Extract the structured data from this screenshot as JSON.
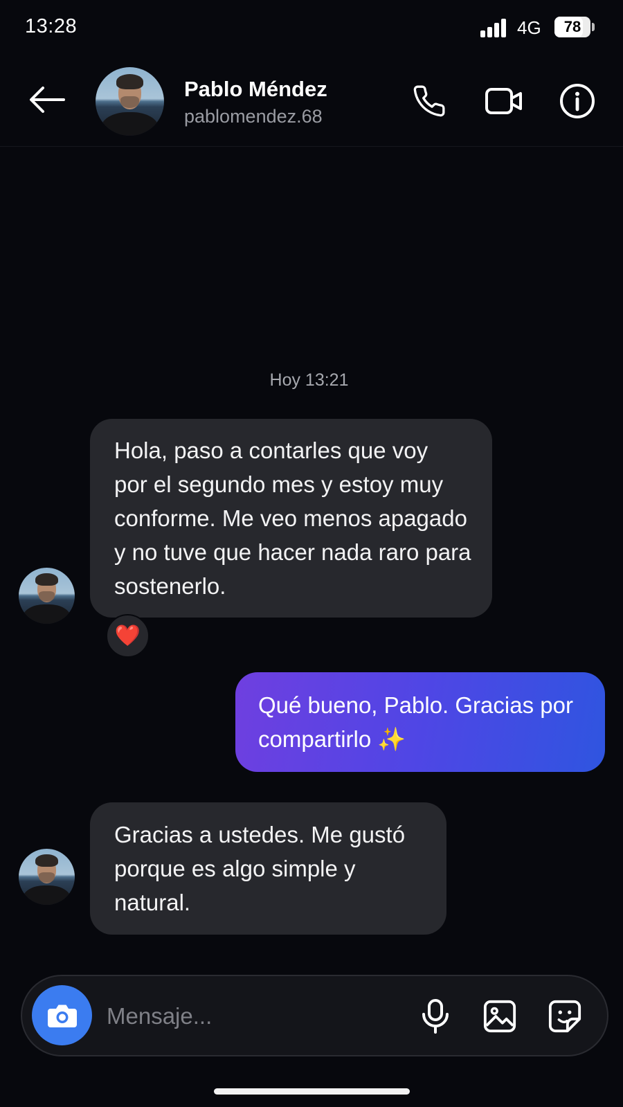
{
  "status_bar": {
    "time": "13:28",
    "network": "4G",
    "battery_level": "78",
    "battery_fraction": 0.78
  },
  "header": {
    "contact_name": "Pablo Méndez",
    "contact_handle": "pablomendez.68",
    "icons": [
      "back-arrow-icon",
      "phone-icon",
      "video-camera-icon",
      "info-icon"
    ]
  },
  "conversation": {
    "timestamp": "Hoy 13:21",
    "messages": [
      {
        "direction": "incoming",
        "lines": [
          "Hola, paso a contarles que voy",
          "por el segundo mes y estoy muy",
          "conforme. Me veo menos apagado",
          "y no tuve que hacer nada raro para",
          "sostenerlo."
        ],
        "reaction": "❤️"
      },
      {
        "direction": "outgoing",
        "lines": [
          "Qué bueno, Pablo. Gracias por",
          "compartirlo ✨"
        ]
      },
      {
        "direction": "incoming",
        "lines": [
          "Gracias a ustedes. Me gustó",
          "porque es algo simple y natural."
        ]
      }
    ]
  },
  "composer": {
    "placeholder": "Mensaje...",
    "icons": [
      "camera-icon",
      "microphone-icon",
      "gallery-icon",
      "sticker-icon"
    ]
  },
  "colors": {
    "background": "#07080d",
    "incoming_bubble": "#27282d",
    "outgoing_gradient_start": "#6f3fe0",
    "outgoing_gradient_end": "#2f55e0",
    "camera_button": "#3b7cf0"
  }
}
